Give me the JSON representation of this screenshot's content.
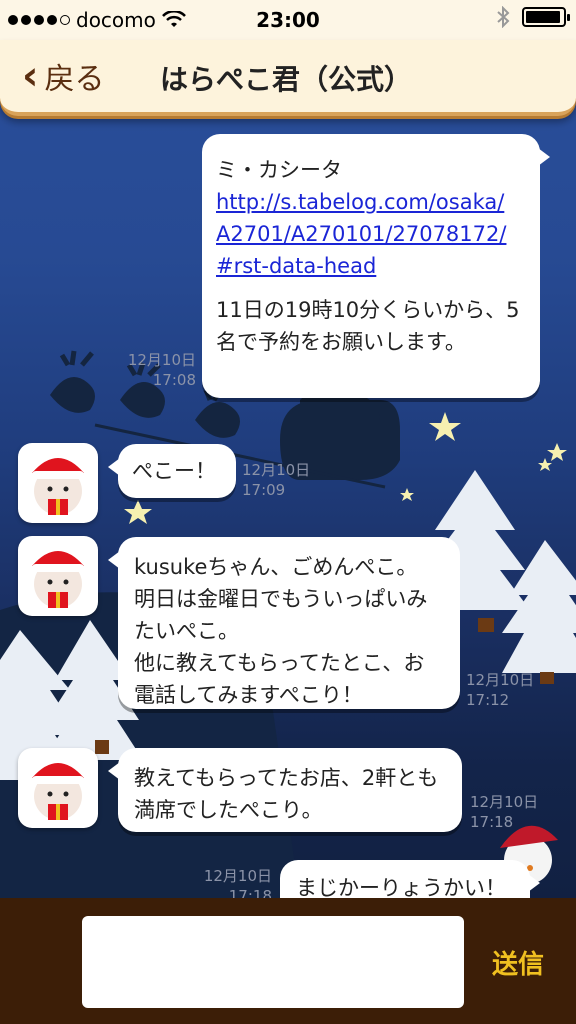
{
  "status_bar": {
    "carrier": "docomo",
    "time": "23:00",
    "signal_bars": 4,
    "signal_total": 5,
    "battery_level": 1.0
  },
  "nav": {
    "back_label": "戻る",
    "title": "はらぺこ君（公式）"
  },
  "messages": [
    {
      "side": "right",
      "line1": "ミ・カシータ",
      "link_lines": [
        "http://s.tabelog.com/osaka/",
        "A2701/A270101/27078172/",
        "#rst-data-head"
      ],
      "line_after1": "11日の19時10分くらいから、5",
      "line_after2": "名で予約をお願いします。",
      "time_date": "12月10日",
      "time_clock": "17:08"
    },
    {
      "side": "left",
      "text": "ぺこー！",
      "time_date": "12月10日",
      "time_clock": "17:09"
    },
    {
      "side": "left",
      "lines": [
        "kusukeちゃん、ごめんぺこ。",
        "明日は金曜日でもういっぱいみ",
        "たいぺこ。",
        "他に教えてもらってたとこ、お",
        "電話してみますぺこり！"
      ],
      "time_date": "12月10日",
      "time_clock": "17:12"
    },
    {
      "side": "left",
      "lines": [
        "教えてもらってたお店、2軒とも",
        "満席でしたぺこり。"
      ],
      "time_date": "12月10日",
      "time_clock": "17:18"
    },
    {
      "side": "right",
      "text": "まじかーりょうかい！",
      "time_date": "12月10日",
      "time_clock": "17:18"
    }
  ],
  "input": {
    "value": "",
    "send_label": "送信"
  },
  "colors": {
    "link": "#1a25d6",
    "send": "#f0c020",
    "nav_bg": "#fdf3dc",
    "input_bar_bg": "#3c1e07"
  },
  "icons": [
    "wifi-icon",
    "bluetooth-icon",
    "battery-icon",
    "back-chevron-icon",
    "avatar-santa-bear-icon"
  ]
}
